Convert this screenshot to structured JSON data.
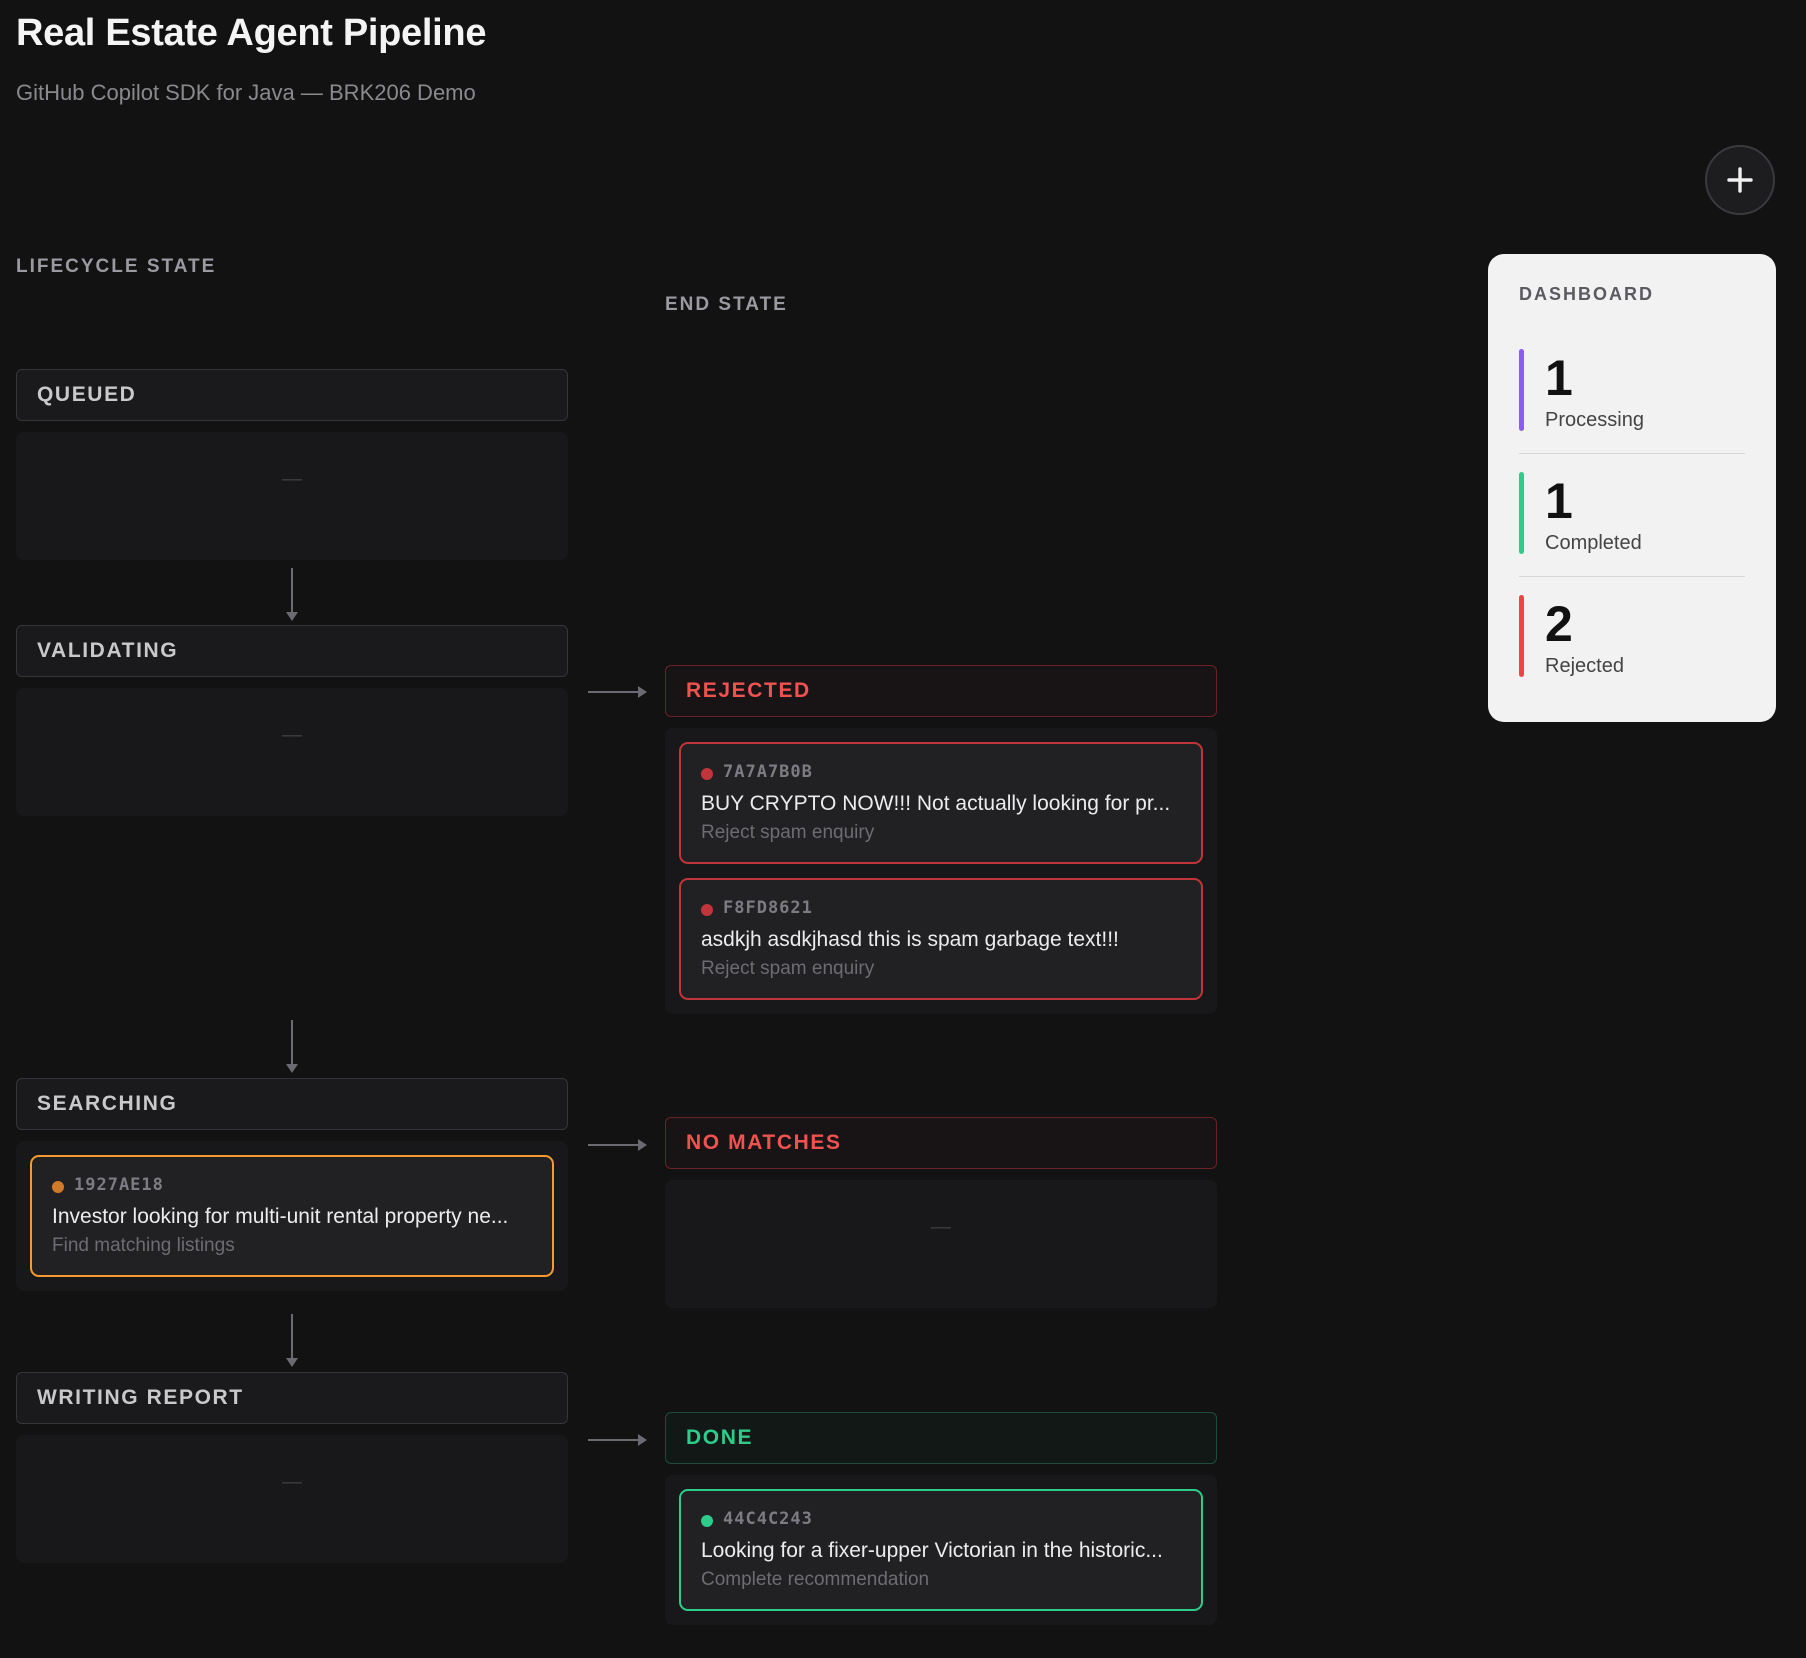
{
  "header": {
    "title": "Real Estate Agent Pipeline",
    "subtitle": "GitHub Copilot SDK for Java — BRK206 Demo"
  },
  "columns": {
    "lifecycle_label": "LIFECYCLE STATE",
    "end_label": "END STATE"
  },
  "lanes": [
    {
      "title": "QUEUED",
      "empty": "—"
    },
    {
      "title": "VALIDATING",
      "empty": "—"
    },
    {
      "title": "SEARCHING",
      "cards": [
        {
          "id": "1927AE18",
          "text": "Investor looking for multi-unit rental property ne...",
          "action": "Find matching listings"
        }
      ]
    },
    {
      "title": "WRITING REPORT",
      "empty": "—"
    }
  ],
  "end_states": [
    {
      "title": "REJECTED",
      "color": "#ef5350",
      "cards": [
        {
          "id": "7A7A7B0B",
          "text": "BUY CRYPTO NOW!!! Not actually looking for pr...",
          "action": "Reject spam enquiry"
        },
        {
          "id": "F8FD8621",
          "text": "asdkjh asdkjhasd this is spam garbage text!!!",
          "action": "Reject spam enquiry"
        }
      ]
    },
    {
      "title": "NO MATCHES",
      "color": "#ef5350",
      "empty": "—"
    },
    {
      "title": "DONE",
      "color": "#2ecc8a",
      "cards": [
        {
          "id": "44C4C243",
          "text": "Looking for a fixer-upper Victorian in the historic...",
          "action": "Complete recommendation"
        }
      ]
    }
  ],
  "dashboard": {
    "title": "DASHBOARD",
    "stats": [
      {
        "value": "1",
        "label": "Processing",
        "color": "#8b5cf6"
      },
      {
        "value": "1",
        "label": "Completed",
        "color": "#2ecc8a"
      },
      {
        "value": "2",
        "label": "Rejected",
        "color": "#ef4444"
      }
    ]
  },
  "icons": {
    "add": "plus-icon",
    "flow_down": "arrow-down-icon",
    "flow_right": "arrow-right-icon",
    "status": "dot-icon"
  }
}
